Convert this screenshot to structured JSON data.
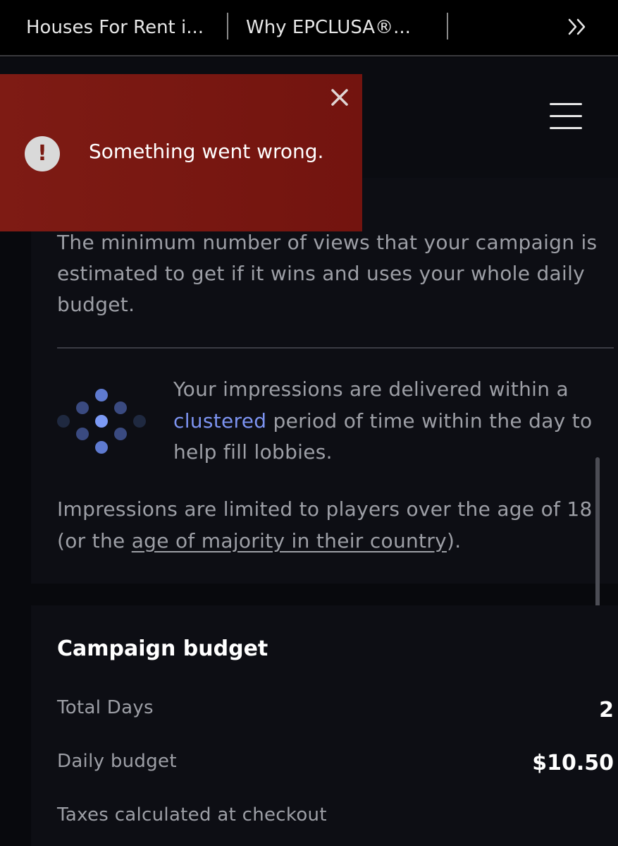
{
  "tabs": [
    {
      "label": "Houses For Rent i..."
    },
    {
      "label": "Why EPCLUSA®..."
    }
  ],
  "overflow_icon": "double-chevron-right-icon",
  "menu_icon": "hamburger-menu-icon",
  "toast": {
    "message": "Something went wrong.",
    "icon": "exclamation-circle-icon",
    "close_icon": "close-icon",
    "color": "#7e1b14"
  },
  "views_description": "The minimum number of views that your campaign is estimated to get if it wins and uses your whole daily budget.",
  "delivery": {
    "icon": "clustered-dots-icon",
    "text_before": "Your impressions are delivered within a ",
    "link": "clustered",
    "text_after": " period of time within the day to help fill lobbies.",
    "link_color": "#7c93f0"
  },
  "age": {
    "text_before": "Impressions are limited to players over the age of 18 (or the ",
    "link": "age of majority in their country",
    "text_after": ")."
  },
  "budget": {
    "title": "Campaign budget",
    "rows": [
      {
        "label": "Total Days",
        "value": "2"
      },
      {
        "label": "Daily budget",
        "value": "$10.50"
      }
    ],
    "note": "Taxes calculated at checkout"
  }
}
